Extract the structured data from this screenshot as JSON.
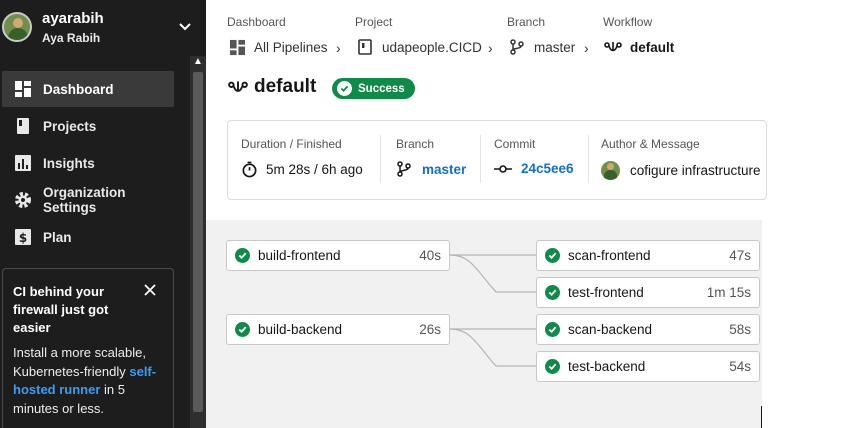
{
  "user": {
    "login": "ayarabih",
    "name": "Aya Rabih"
  },
  "nav": [
    {
      "label": "Dashboard",
      "icon": "dashboard-icon",
      "active": true
    },
    {
      "label": "Projects",
      "icon": "projects-icon"
    },
    {
      "label": "Insights",
      "icon": "insights-icon"
    },
    {
      "label": "Organization Settings",
      "icon": "gear-icon"
    },
    {
      "label": "Plan",
      "icon": "dollar-icon"
    }
  ],
  "promo": {
    "title": "CI behind your firewall just got easier",
    "body_before": "Install a more scalable, Kubernetes-friendly",
    "link": "self-hosted runner",
    "body_after": "in 5 minutes or less."
  },
  "breadcrumb": {
    "dashboard": {
      "label": "Dashboard",
      "value": "All Pipelines"
    },
    "project": {
      "label": "Project",
      "value": "udapeople.CICD"
    },
    "branch": {
      "label": "Branch",
      "value": "master"
    },
    "workflow": {
      "label": "Workflow",
      "value": "default"
    }
  },
  "workflow": {
    "name": "default",
    "status": "Success"
  },
  "summary": {
    "duration": {
      "label": "Duration / Finished",
      "value": "5m 28s / 6h ago"
    },
    "branch": {
      "label": "Branch",
      "value": "master"
    },
    "commit": {
      "label": "Commit",
      "value": "24c5ee6"
    },
    "author": {
      "label": "Author & Message",
      "value": "cofigure infrastructure"
    }
  },
  "jobs": [
    {
      "name": "build-frontend",
      "duration": "40s"
    },
    {
      "name": "scan-frontend",
      "duration": "47s"
    },
    {
      "name": "test-frontend",
      "duration": "1m 15s"
    },
    {
      "name": "build-backend",
      "duration": "26s"
    },
    {
      "name": "scan-backend",
      "duration": "58s"
    },
    {
      "name": "test-backend",
      "duration": "54s"
    }
  ],
  "colors": {
    "sidebar": "#1d1d1d",
    "success": "#0f8a48",
    "link": "#1370c8",
    "promo_link": "#3a9cf2"
  }
}
